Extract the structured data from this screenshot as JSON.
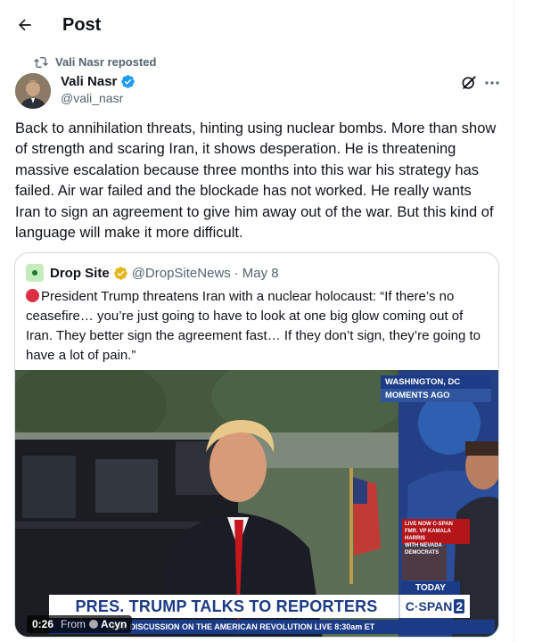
{
  "header": {
    "title": "Post"
  },
  "repost": {
    "text": "Vali Nasr reposted"
  },
  "author": {
    "name": "Vali Nasr",
    "handle": "@vali_nasr"
  },
  "post": {
    "text": "Back to annihilation threats, hinting using nuclear bombs. More than show of strength and scaring Iran, it shows desperation. He is threatening massive escalation because three months into this war his strategy has failed. Air war failed and the blockade has not worked. He really wants Iran to sign an agreement to give him away out of the war. But this kind of language will make it more difficult."
  },
  "quote": {
    "name": "Drop Site",
    "handle": "@DropSiteNews",
    "separator": "·",
    "date": "May 8",
    "text": "President Trump threatens Iran with a nuclear holocaust: “If there’s no ceasefire… you’re just going to have to look at one big glow coming out of Iran. They better sign the agreement fast… If they don’t sign, they’re going to have a lot of pain.”"
  },
  "video": {
    "location_line1": "WASHINGTON, DC",
    "location_line2": "MOMENTS AGO",
    "live_line1": "LIVE NOW C-SPAN",
    "live_line2": "FMR. VP KAMALA HARRIS",
    "live_line3": "WITH NEVADA DEMOCRATS",
    "today": "TODAY",
    "lower_third": "PRES. TRUMP TALKS TO REPORTERS",
    "network": "C·SPAN",
    "network_num": "2",
    "ticker": "250: DISCUSSION ON THE AMERICAN REVOLUTION  LIVE 8:30am ET",
    "time": "0:26",
    "from_label": "From",
    "source": "Acyn"
  },
  "colors": {
    "accent": "#1d9bf0",
    "gold_badge": "#e2b719",
    "text_secondary": "#536471"
  }
}
